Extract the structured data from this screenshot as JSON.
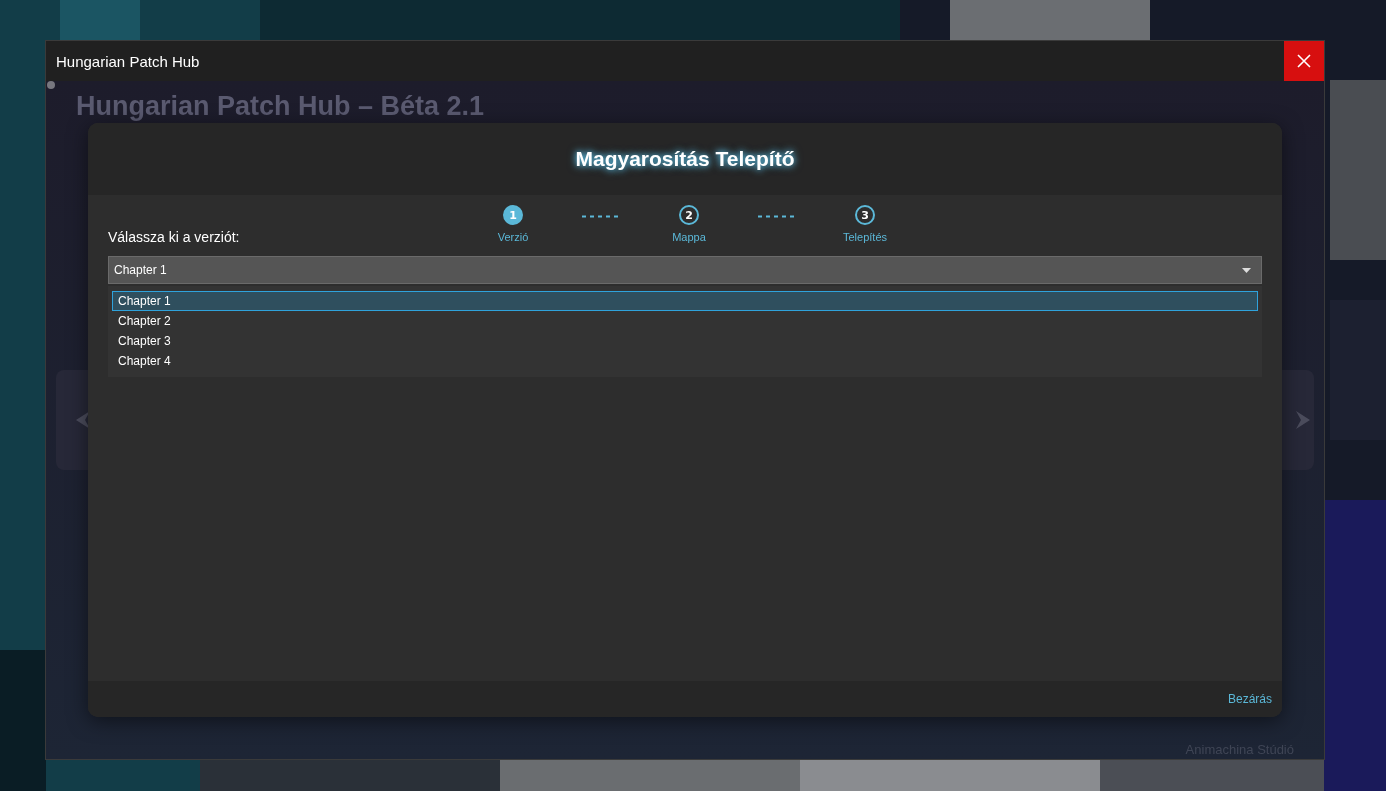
{
  "window": {
    "title": "Hungarian Patch Hub"
  },
  "app": {
    "heading": "Hungarian Patch Hub – Béta 2.1",
    "footer": "Animachina Stúdió"
  },
  "dialog": {
    "title": "Magyarosítás Telepítő",
    "steps": [
      {
        "number": "1",
        "label": "Verzió",
        "selected": true
      },
      {
        "number": "2",
        "label": "Mappa",
        "selected": false
      },
      {
        "number": "3",
        "label": "Telepítés",
        "selected": false
      }
    ],
    "prompt": "Válassza ki a verziót:",
    "select": {
      "value": "Chapter 1",
      "expanded": true
    },
    "options": [
      {
        "label": "Chapter 1",
        "selected": true
      },
      {
        "label": "Chapter 2",
        "selected": false
      },
      {
        "label": "Chapter 3",
        "selected": false
      },
      {
        "label": "Chapter 4",
        "selected": false
      }
    ],
    "close_label": "Bezárás"
  }
}
